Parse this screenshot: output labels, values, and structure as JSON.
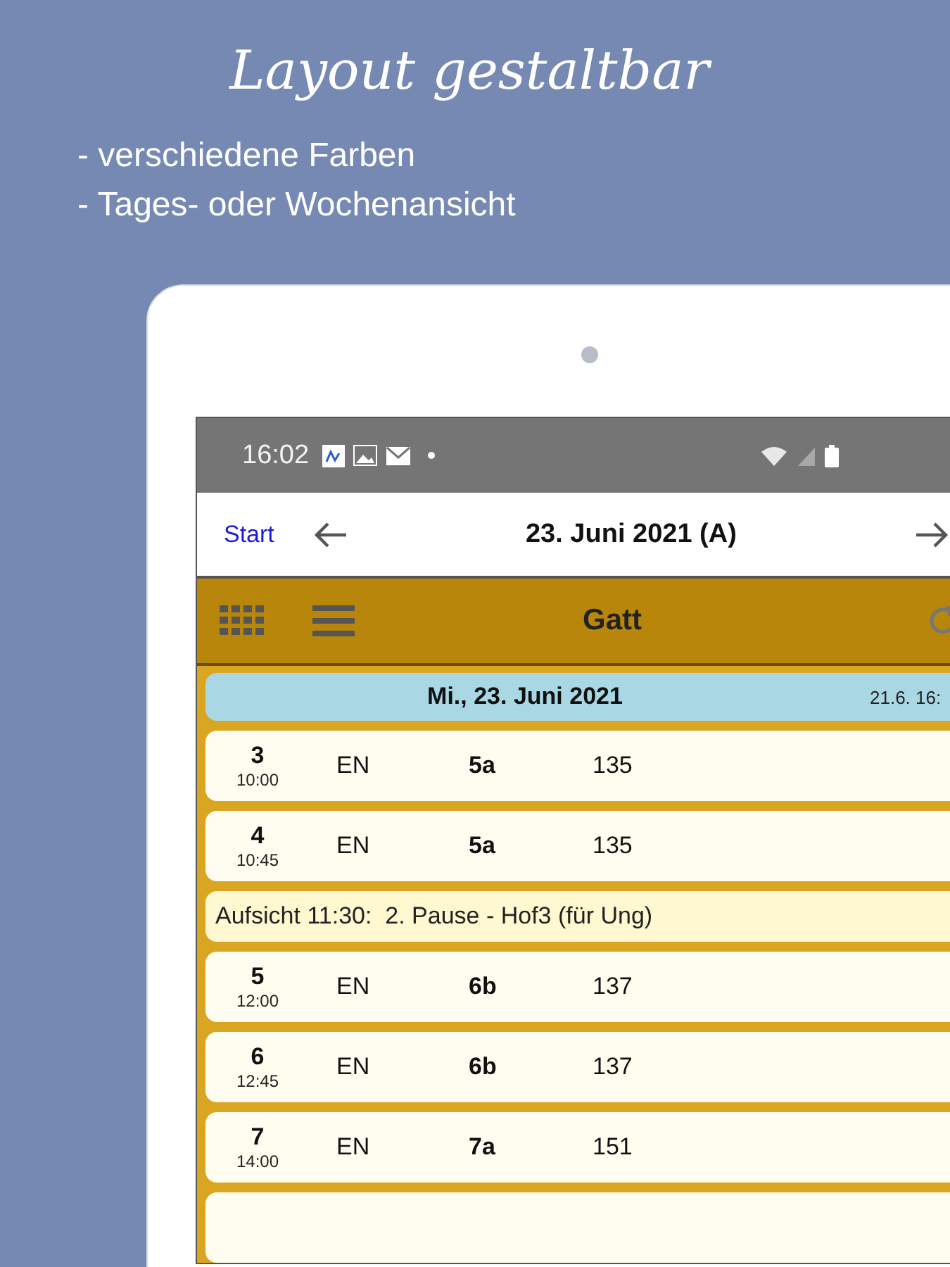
{
  "headline": "Layout gestaltbar",
  "bullets": [
    "- verschiedene Farben",
    "- Tages- oder Wochenansicht"
  ],
  "status_bar": {
    "time": "16:02"
  },
  "nav": {
    "start": "Start",
    "title": "23. Juni 2021 (A)"
  },
  "toolbar": {
    "title": "Gatt"
  },
  "day_header": {
    "date": "Mi., 23. Juni 2021",
    "stamp": "21.6. 16:"
  },
  "rows": [
    {
      "kind": "lesson",
      "period": "3",
      "time": "10:00",
      "subject": "EN",
      "class": "5a",
      "room": "135"
    },
    {
      "kind": "lesson",
      "period": "4",
      "time": "10:45",
      "subject": "EN",
      "class": "5a",
      "room": "135"
    },
    {
      "kind": "duty",
      "text": "Aufsicht 11:30:  2. Pause - Hof3 (für Ung)"
    },
    {
      "kind": "lesson",
      "period": "5",
      "time": "12:00",
      "subject": "EN",
      "class": "6b",
      "room": "137"
    },
    {
      "kind": "lesson",
      "period": "6",
      "time": "12:45",
      "subject": "EN",
      "class": "6b",
      "room": "137"
    },
    {
      "kind": "lesson",
      "period": "7",
      "time": "14:00",
      "subject": "EN",
      "class": "7a",
      "room": "151"
    },
    {
      "kind": "lesson"
    }
  ]
}
